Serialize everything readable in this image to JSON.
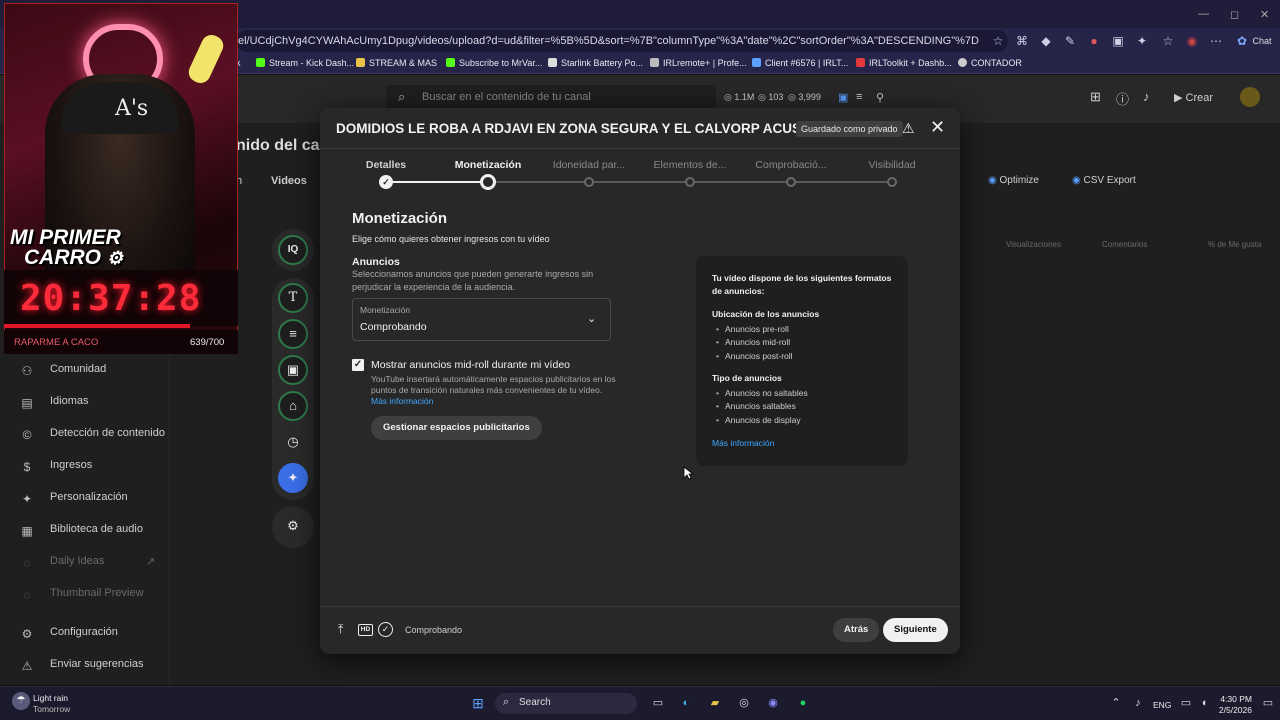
{
  "browser": {
    "url": "el/UCdjChVg4CYWAhAcUmy1Dpug/videos/upload?d=ud&filter=%5B%5D&sort=%7B\"columnType\"%3A\"date\"%2C\"sortOrder\"%3A\"DESCENDING\"%7D",
    "chat_label": "Chat",
    "bookmarks": [
      {
        "label": "Stream - Kick Dash...",
        "color": "#53fc18"
      },
      {
        "label": "STREAM & MAS",
        "color": "#e8c24a"
      },
      {
        "label": "Subscribe to MrVar...",
        "color": "#53fc18"
      },
      {
        "label": "Starlink Battery Po...",
        "color": "#dddddd"
      },
      {
        "label": "IRLremote+ | Profe...",
        "color": "#bbbbbb"
      },
      {
        "label": "Client #6576 | IRLT...",
        "color": "#5aa0ff"
      },
      {
        "label": "IRLToolkit + Dashb...",
        "color": "#e23a3a"
      },
      {
        "label": "CONTADOR",
        "color": "#cccccc"
      }
    ]
  },
  "studio": {
    "search_placeholder": "Buscar en el contenido de tu canal",
    "stats": [
      "1.1M",
      "103",
      "3,999"
    ],
    "create_label": "Crear",
    "page_title_partial": "nido del can",
    "tab_videos": "Videos",
    "tab_partial": "n",
    "optimize_label": "Optimize",
    "csv_label": "CSV Export",
    "col_views": "Visualizaciones",
    "col_comments": "Comentarios",
    "col_likes": "% de Me gusta",
    "sidebar": [
      {
        "label": "Comunidad",
        "icon": "people-icon"
      },
      {
        "label": "Idiomas",
        "icon": "translate-icon"
      },
      {
        "label": "Detección de contenido",
        "icon": "copyright-icon"
      },
      {
        "label": "Ingresos",
        "icon": "dollar-icon"
      },
      {
        "label": "Personalización",
        "icon": "wand-icon"
      },
      {
        "label": "Biblioteca de audio",
        "icon": "audio-library-icon"
      },
      {
        "label": "Daily Ideas",
        "icon": "bulb-icon"
      },
      {
        "label": "Thumbnail Preview",
        "icon": "thumbnail-icon"
      },
      {
        "label": "Configuración",
        "icon": "gear-icon"
      },
      {
        "label": "Enviar sugerencias",
        "icon": "feedback-icon"
      }
    ]
  },
  "overlay": {
    "cam_label_1": "MI PRIMER",
    "cam_label_2": "CARRO",
    "clock": "20:37:28",
    "goal_label": "RAPARME A CACO",
    "goal_count": "639/700",
    "goal_progress": 0.913
  },
  "modal": {
    "title": "DOMIDIOS LE ROBA A RDJAVI EN ZONA SEGURA Y EL CALVORP ACUSAD...",
    "saved_badge": "Guardado como privado",
    "steps": [
      {
        "label": "Detalles",
        "state": "done"
      },
      {
        "label": "Monetización",
        "state": "active"
      },
      {
        "label": "Idoneidad par...",
        "state": "todo"
      },
      {
        "label": "Elementos de...",
        "state": "todo"
      },
      {
        "label": "Comprobació...",
        "state": "todo"
      },
      {
        "label": "Visibilidad",
        "state": "todo"
      }
    ],
    "section_title": "Monetización",
    "section_subtitle": "Elige cómo quieres obtener ingresos con tu vídeo",
    "ads_title": "Anuncios",
    "ads_desc": "Seleccionamos anuncios que pueden generarte ingresos sin perjudicar la experiencia de la audiencia.",
    "select_label": "Monetización",
    "select_value": "Comprobando",
    "midroll_label": "Mostrar anuncios mid-roll durante mi vídeo",
    "midroll_checked": true,
    "midroll_desc": "YouTube insertará automáticamente espacios publicitarios en los puntos de transición naturales más convenientes de tu vídeo.",
    "midroll_link": "Más información",
    "manage_button": "Gestionar espacios publicitarios",
    "info": {
      "heading": "Tu vídeo dispone de los siguientes formatos de anuncios:",
      "placement_title": "Ubicación de los anuncios",
      "placements": [
        "Anuncios pre-roll",
        "Anuncios mid-roll",
        "Anuncios post-roll"
      ],
      "type_title": "Tipo de anuncios",
      "types": [
        "Anuncios no saltables",
        "Anuncios saltables",
        "Anuncios de display"
      ],
      "link": "Más información"
    },
    "footer_status": "Comprobando",
    "back_button": "Atrás",
    "next_button": "Siguiente"
  },
  "taskbar": {
    "weather_1": "Light rain",
    "weather_2": "Tomorrow",
    "search_label": "Search",
    "lang": "ENG",
    "time": "4:30 PM",
    "date": "2/5/2026"
  }
}
